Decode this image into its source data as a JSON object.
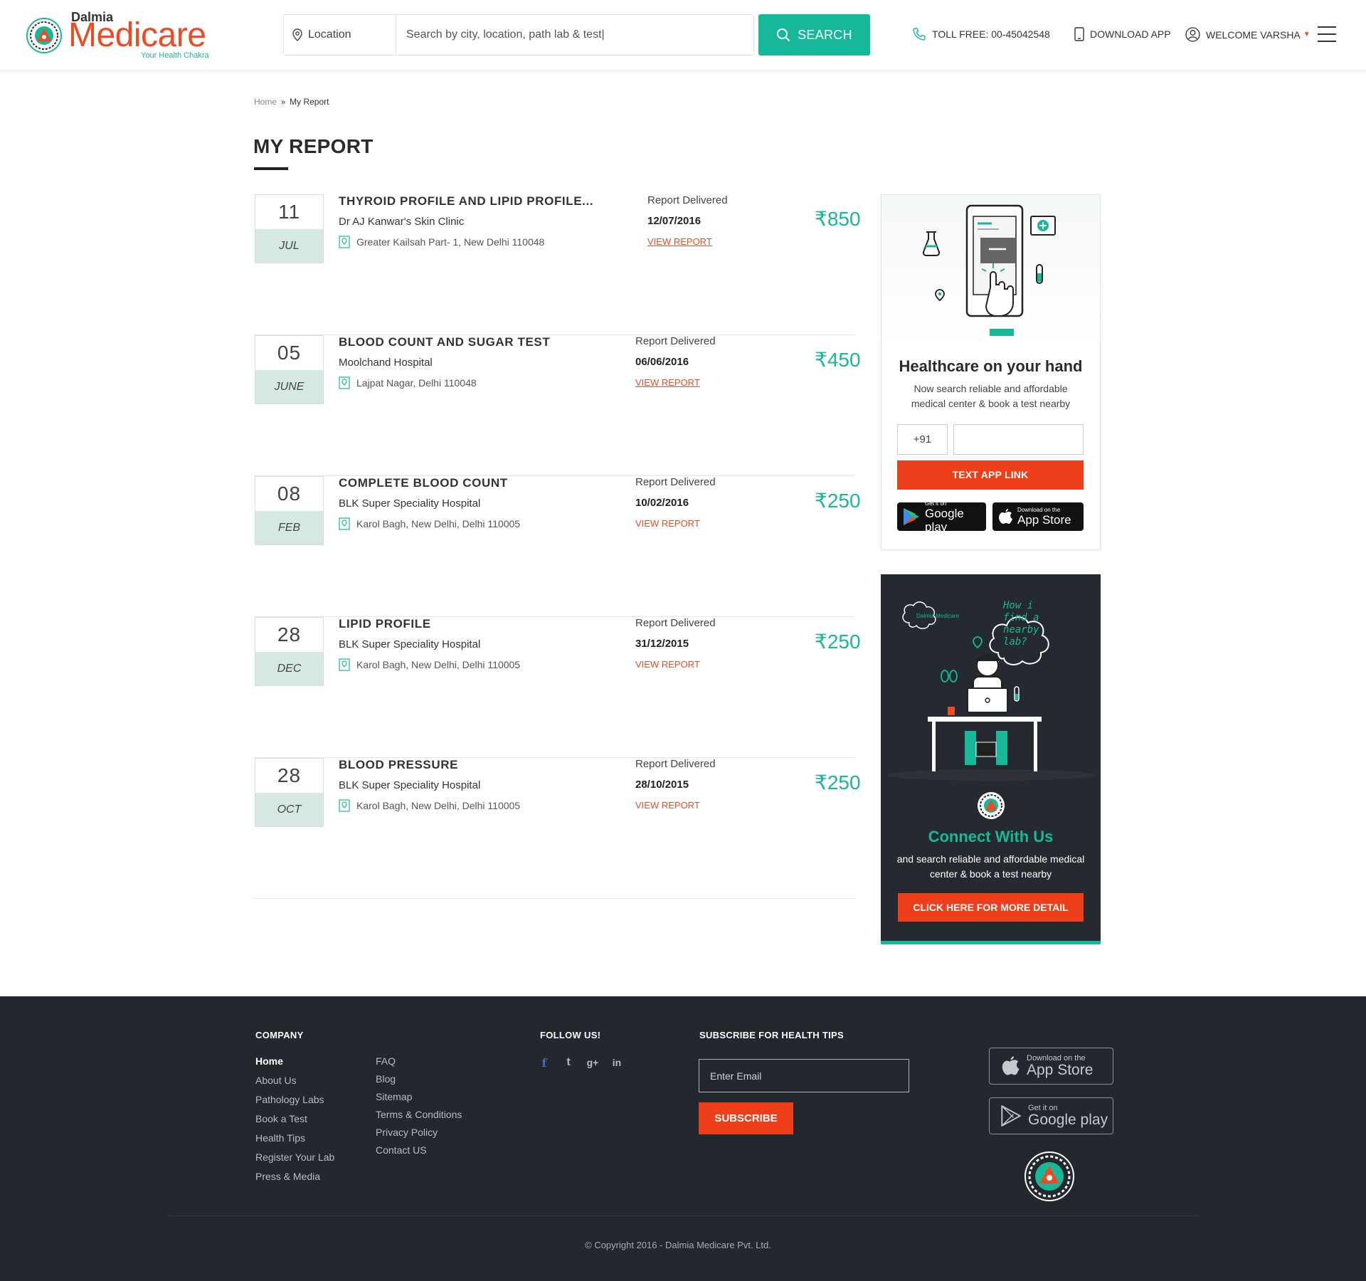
{
  "brand": {
    "top": "Dalmia",
    "name": "Medicare",
    "tagline": "Your Health Chakra",
    "accent": "#ee4a23",
    "teal": "#17b89a"
  },
  "header": {
    "location_label": "Location",
    "search_value": "Search by city, location, path lab & test|",
    "search_button": "SEARCH",
    "toll_free": "TOLL FREE: 00-45042548",
    "download_app": "DOWNLOAD APP",
    "welcome": "WELCOME VARSHA"
  },
  "breadcrumb": {
    "home": "Home",
    "current": "My Report"
  },
  "page": {
    "title": "MY REPORT"
  },
  "reports": [
    {
      "day": "11",
      "month": "JUL",
      "name": "THYROID PROFILE AND LIPID PROFILE...",
      "lab": "Dr AJ Kanwar's Skin Clinic",
      "address": "Greater Kailsah Part- 1, New Delhi 110048",
      "status": "Report Delivered",
      "date": "12/07/2016",
      "action": "VIEW REPORT",
      "price": "₹850"
    },
    {
      "day": "05",
      "month": "JUNE",
      "name": "BLOOD COUNT AND SUGAR TEST",
      "lab": "Moolchand Hospital",
      "address": "Lajpat Nagar, Delhi 110048",
      "status": "Report Delivered",
      "date": "06/06/2016",
      "action": "VIEW REPORT",
      "price": "₹450"
    },
    {
      "day": "08",
      "month": "FEB",
      "name": "COMPLETE BLOOD COUNT",
      "lab": "BLK Super Speciality Hospital",
      "address": "Karol Bagh, New Delhi, Delhi 110005",
      "status": "Report Delivered",
      "date": "10/02/2016",
      "action": "VIEW REPORT",
      "price": "₹250"
    },
    {
      "day": "28",
      "month": "DEC",
      "name": "LIPID PROFILE",
      "lab": "BLK Super Speciality Hospital",
      "address": "Karol Bagh, New Delhi, Delhi 110005",
      "status": "Report Delivered",
      "date": "31/12/2015",
      "action": "VIEW REPORT",
      "price": "₹250"
    },
    {
      "day": "28",
      "month": "OCT",
      "name": "BLOOD PRESSURE",
      "lab": "BLK Super Speciality Hospital",
      "address": "Karol Bagh, New Delhi, Delhi 110005",
      "status": "Report Delivered",
      "date": "28/10/2015",
      "action": "VIEW REPORT",
      "price": "₹250"
    }
  ],
  "app_card": {
    "title": "Healthcare on your hand",
    "text": "Now search reliable and affordable medical center & book a test nearby",
    "country_code": "+91",
    "phone_placeholder": "",
    "button": "TEXT APP LINK",
    "google_small": "Get it on",
    "google_big": "Google play",
    "apple_small": "Download on the",
    "apple_big": "App Store"
  },
  "connect_card": {
    "cloud_brand": "Dalmia Medicare",
    "thought": "How i find a nearby lab?",
    "title": "Connect With Us",
    "text": "and search reliable and affordable medical center & book a test nearby",
    "button": "CLICK HERE FOR MORE DETAIL"
  },
  "footer": {
    "company_heading": "COMPANY",
    "company_links": [
      "Home",
      "About Us",
      "Pathology Labs",
      "Book a Test",
      "Health Tips",
      "Register Your Lab",
      "Press & Media"
    ],
    "more_links": [
      "FAQ",
      "Blog",
      "Sitemap",
      "Terms & Conditions",
      "Privacy Policy",
      "Contact US"
    ],
    "follow_heading": "FOLLOW US!",
    "social_icons": [
      "facebook-icon",
      "twitter-icon",
      "google-plus-icon",
      "linkedin-icon"
    ],
    "subscribe_heading": "SUBSCRIBE FOR HEALTH TIPS",
    "email_placeholder": "Enter Email",
    "subscribe_button": "SUBSCRIBE",
    "apple_small": "Download on the",
    "apple_big": "App Store",
    "google_small": "Get it on",
    "google_big": "Google play",
    "copyright": "© Copyright 2016 - Dalmia Medicare Pvt. Ltd."
  }
}
